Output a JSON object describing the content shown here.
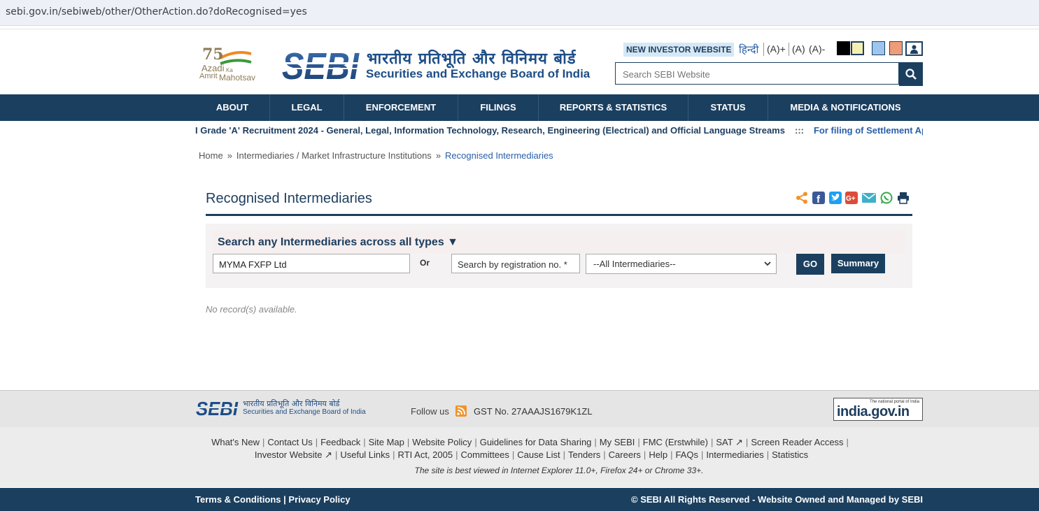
{
  "browser": {
    "url": "sebi.gov.in/sebiweb/other/OtherAction.do?doRecognised=yes"
  },
  "header": {
    "azadi": {
      "number": "75",
      "line1": "Azadi",
      "line2": "Ka",
      "line3": "Amrit",
      "line4": "Mahotsav"
    },
    "sebi_logo_text": "SEBI",
    "title_hindi": "भारतीय प्रतिभूति और विनिमय बोर्ड",
    "title_english": "Securities and Exchange Board of India",
    "new_investor": "NEW INVESTOR WEBSITE",
    "hindi_link": "हिन्दी",
    "font_increase": "(A)+",
    "font_normal": "(A)",
    "font_decrease": "(A)-",
    "theme_colors": [
      "#000000",
      "#f5f0b0",
      "#9ec5ef",
      "#ef9c78"
    ],
    "search_placeholder": "Search SEBI Website",
    "search_icon": "search-icon"
  },
  "nav": [
    "ABOUT",
    "LEGAL",
    "ENFORCEMENT",
    "FILINGS",
    "REPORTS & STATISTICS",
    "STATUS",
    "MEDIA & NOTIFICATIONS"
  ],
  "ticker": {
    "item1": "I Grade 'A' Recruitment 2024 - General, Legal, Information Technology, Research, Engineering (Electrical) and Official Language Streams",
    "separator": ":::",
    "item2": "For filing of Settlement Application"
  },
  "breadcrumb": [
    "Home",
    "Intermediaries / Market Infrastructure Institutions",
    "Recognised Intermediaries"
  ],
  "breadcrumb_sep": "»",
  "main": {
    "title": "Recognised Intermediaries",
    "share_icons": [
      "share-icon",
      "facebook-icon",
      "twitter-icon",
      "google-plus-icon",
      "email-icon",
      "whatsapp-icon",
      "print-icon"
    ],
    "search_heading": "Search any Intermediaries across all types ▼",
    "name_value": "MYMA FXFP Ltd",
    "or_label": "Or",
    "reg_placeholder": "Search by registration no. *",
    "type_selected": "--All Intermediaries--",
    "go_label": "GO",
    "summary_label": "Summary",
    "no_records": "No record(s) available."
  },
  "footer": {
    "logo_hindi": "भारतीय प्रतिभूति और विनिमय बोर्ड",
    "logo_english": "Securities and Exchange Board of India",
    "follow_us": "Follow us",
    "gst": "GST No. 27AAAJS1679K1ZL",
    "india_portal_small": "The national portal of India",
    "india_portal": "india.gov.in",
    "links_row1": [
      "What's New",
      "Contact Us",
      "Feedback",
      "Site Map",
      "Website Policy",
      "Guidelines for Data Sharing",
      "My SEBI",
      "FMC (Erstwhile)",
      "SAT ↗",
      "Screen Reader Access"
    ],
    "links_row2": [
      "Investor Website ↗",
      "Useful Links",
      "RTI Act, 2005",
      "Committees",
      "Cause List",
      "Tenders",
      "Careers",
      "Help",
      "FAQs",
      "Intermediaries",
      "Statistics"
    ],
    "best_viewed": "The site is best viewed in Internet Explorer 11.0+, Firefox 24+ or Chrome 33+.",
    "terms": "Terms & Conditions",
    "privacy": "Privacy Policy",
    "copyright": "© SEBI All Rights Reserved - Website Owned and Managed by SEBI"
  }
}
